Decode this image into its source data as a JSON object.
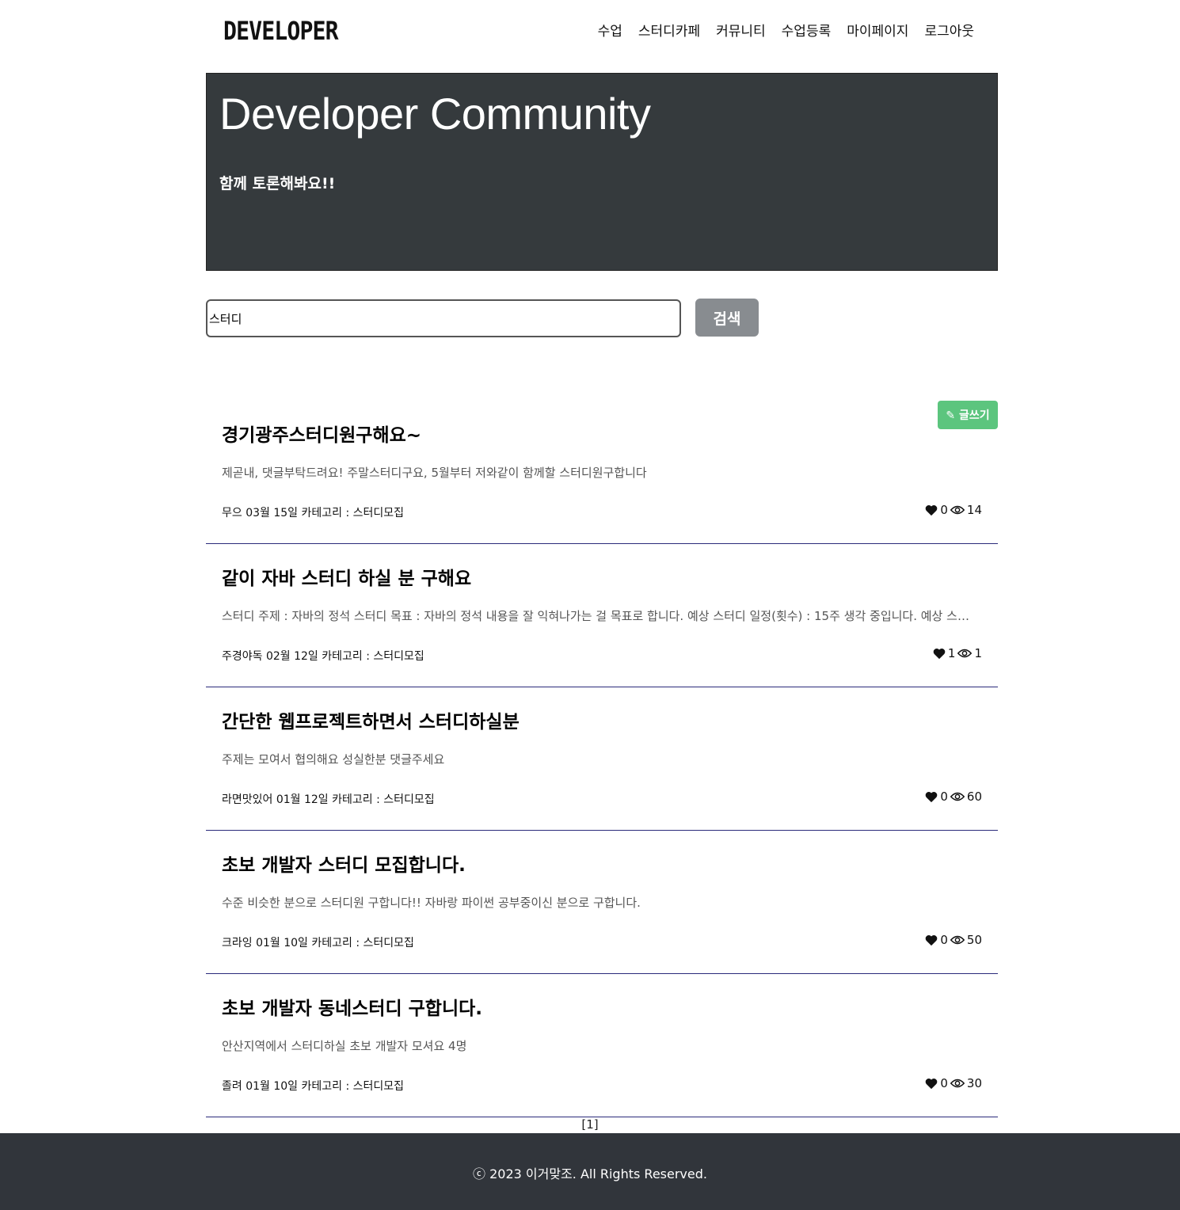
{
  "header": {
    "logo": "DEVELOPER",
    "nav": [
      "수업",
      "스터디카페",
      "커뮤니티",
      "수업등록",
      "마이페이지",
      "로그아웃"
    ]
  },
  "hero": {
    "title": "Developer Community",
    "subtitle": "함께 토론해봐요!!"
  },
  "search": {
    "value": "스터디",
    "button_label": "검색"
  },
  "write_button_label": "✎ 글쓰기",
  "posts": [
    {
      "title": "경기광주스터디원구해요~",
      "excerpt": "제곧내, 댓글부탁드려요! 주말스터디구요, 5월부터 저와같이 함께할 스터디원구합니다",
      "meta": "무으 03월 15일 카테고리 : 스터디모집",
      "likes": "0",
      "views": "14"
    },
    {
      "title": "같이 자바 스터디 하실 분 구해요",
      "excerpt": "스터디 주제 : 자바의 정석 스터디 목표 : 자바의 정석 내용을 잘 익혀나가는 걸 목표로 합니다. 예상 스터디 일정(횟수) : 15주 생각 중입니다. 예상 스터디 일정",
      "meta": "주경야독 02월 12일 카테고리 : 스터디모집",
      "likes": "1",
      "views": "1"
    },
    {
      "title": "간단한 웹프로젝트하면서 스터디하실분",
      "excerpt": "주제는 모여서 협의해요 성실한분 댓글주세요",
      "meta": "라면맛있어 01월 12일 카테고리 : 스터디모집",
      "likes": "0",
      "views": "60"
    },
    {
      "title": "초보 개발자 스터디 모집합니다.",
      "excerpt": "수준 비슷한 분으로 스터디원 구합니다!! 자바랑 파이썬 공부중이신 분으로 구합니다.",
      "meta": "크라잉 01월 10일 카테고리 : 스터디모집",
      "likes": "0",
      "views": "50"
    },
    {
      "title": "초보 개발자 동네스터디 구합니다.",
      "excerpt": "안산지역에서 스터디하실 초보 개발자 모셔요 4명",
      "meta": "졸려 01월 10일 카테고리 : 스터디모집",
      "likes": "0",
      "views": "30"
    }
  ],
  "pagination": "[1]",
  "footer": "ⓒ 2023 이거맞조. All Rights Reserved."
}
